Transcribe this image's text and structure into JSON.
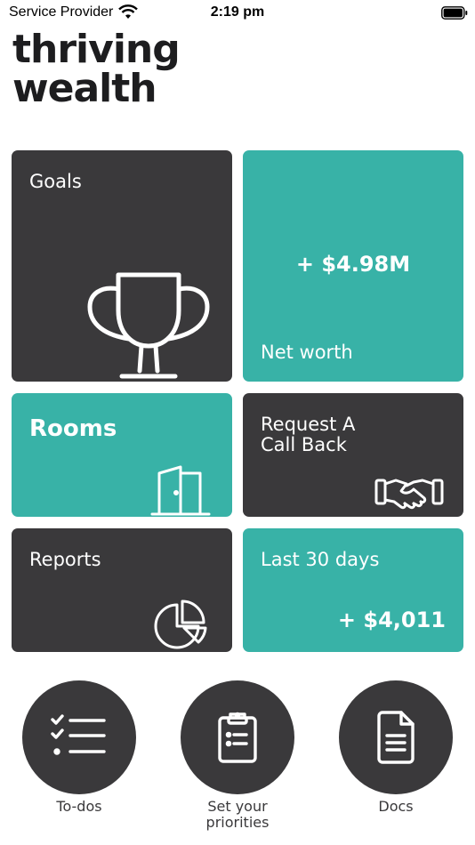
{
  "status_bar": {
    "carrier": "Service Provider",
    "time": "2:19 pm"
  },
  "logo": {
    "line1": "thriving",
    "line2": "wealth"
  },
  "tiles": {
    "goals": {
      "label": "Goals",
      "icon": "trophy-icon"
    },
    "net_worth": {
      "value": "+ $4.98M",
      "label": "Net worth"
    },
    "rooms": {
      "label": "Rooms",
      "icon": "door-icon"
    },
    "call_back": {
      "label_line1": "Request A",
      "label_line2": "Call Back",
      "icon": "handshake-icon"
    },
    "reports": {
      "label": "Reports",
      "icon": "pie-chart-icon"
    },
    "last_30_days": {
      "label": "Last 30 days",
      "value": "+ $4,011"
    }
  },
  "bottom_actions": [
    {
      "label": "To-dos",
      "icon": "checklist-icon"
    },
    {
      "label_line1": "Set your",
      "label_line2": "priorities",
      "icon": "clipboard-icon"
    },
    {
      "label": "Docs",
      "icon": "document-icon"
    }
  ],
  "colors": {
    "dark_tile": "#3a393b",
    "teal_tile": "#38b2a7",
    "logo_text": "#1d1d1f"
  }
}
